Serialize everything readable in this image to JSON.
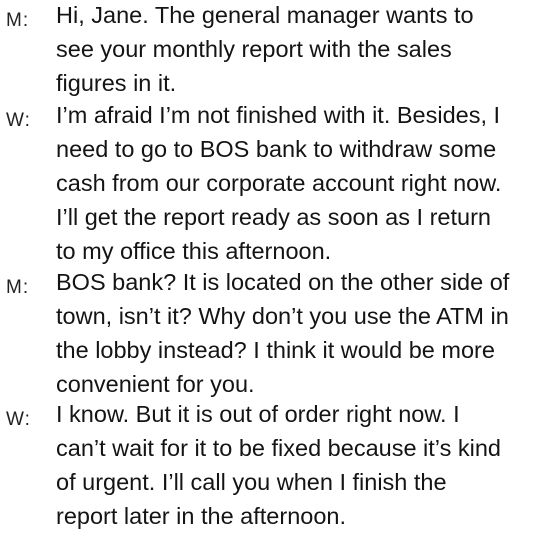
{
  "dialogue": [
    {
      "speaker": "M:",
      "lines": [
        "Hi, Jane. The general manager wants to",
        "see your monthly report with the sales",
        "figures in it."
      ]
    },
    {
      "speaker": "W:",
      "lines": [
        "I’m afraid I’m not finished with it. Besides, I",
        "need to go to BOS bank to withdraw some",
        "cash from our corporate account right now.",
        "I’ll get the report ready as soon as I return",
        "to my office this afternoon."
      ]
    },
    {
      "speaker": "M:",
      "lines": [
        "BOS bank? It is located on the other side of",
        "town, isn’t it? Why don’t you use the ATM in",
        "the lobby instead? I think it would be more",
        "convenient for you."
      ]
    },
    {
      "speaker": "W:",
      "lines": [
        "I know. But it is out of order right now. I",
        "can’t wait for it to be fixed because it’s kind",
        "of urgent. I’ll call you when I finish the",
        "report later in the afternoon."
      ]
    }
  ]
}
